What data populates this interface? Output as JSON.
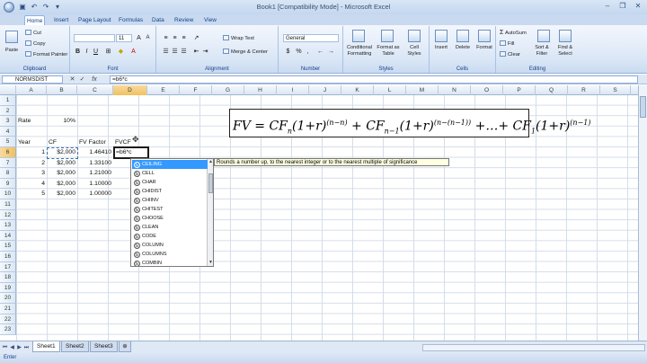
{
  "window": {
    "title": "Book1 [Compatibility Mode] - Microsoft Excel",
    "minimize": "–",
    "restore": "❐",
    "close": "✕"
  },
  "tabs": [
    "Home",
    "Insert",
    "Page Layout",
    "Formulas",
    "Data",
    "Review",
    "View"
  ],
  "ribbon": {
    "clipboard": {
      "label": "Clipboard",
      "paste": "Paste",
      "cut": "Cut",
      "copy": "Copy",
      "format_painter": "Format Painter"
    },
    "font": {
      "label": "Font",
      "font_name": "",
      "font_size": "11",
      "bold": "B",
      "italic": "I",
      "underline": "U"
    },
    "alignment": {
      "label": "Alignment",
      "wrap_text": "Wrap Text",
      "merge_center": "Merge & Center"
    },
    "number": {
      "label": "Number",
      "format": "General",
      "currency": "$",
      "percent": "%",
      "comma": ","
    },
    "styles": {
      "label": "Styles",
      "conditional": "Conditional Formatting",
      "format_table": "Format as Table",
      "cell_styles": "Cell Styles"
    },
    "cells": {
      "label": "Cells",
      "insert": "Insert",
      "delete": "Delete",
      "format": "Format"
    },
    "editing": {
      "label": "Editing",
      "autosum": "AutoSum",
      "fill": "Fill",
      "clear": "Clear",
      "sort_filter": "Sort & Filter",
      "find_select": "Find & Select"
    }
  },
  "formula_bar": {
    "name_box": "NORMSDIST",
    "formula": "=b6*c"
  },
  "columns": [
    "A",
    "B",
    "C",
    "D",
    "E",
    "F",
    "G",
    "H",
    "I",
    "J",
    "K",
    "L",
    "M",
    "N",
    "O",
    "P",
    "Q",
    "R",
    "S",
    "T"
  ],
  "rows": [
    "1",
    "2",
    "3",
    "4",
    "5",
    "6",
    "7",
    "8",
    "9",
    "10",
    "11",
    "12",
    "13",
    "14",
    "15",
    "16",
    "17",
    "18",
    "19",
    "20",
    "21",
    "22",
    "23"
  ],
  "sheet": {
    "rate_label": "Rate",
    "rate_value": "10%",
    "headers": [
      "Year",
      "CF",
      "FV Factor",
      "FVCF"
    ],
    "data": [
      {
        "year": "1",
        "cf": "$2,000",
        "factor": "1.46410"
      },
      {
        "year": "2",
        "cf": "$2,000",
        "factor": "1.33100"
      },
      {
        "year": "3",
        "cf": "$2,000",
        "factor": "1.21000"
      },
      {
        "year": "4",
        "cf": "$2,000",
        "factor": "1.10000"
      },
      {
        "year": "5",
        "cf": "$2,000",
        "factor": "1.00000"
      }
    ],
    "active_cell_text": "=b6*c"
  },
  "formula_image": {
    "lead": "FV = CF",
    "sub_n": "n",
    "p1": "(1+r)",
    "exp1": "(n−n)",
    "plus1": " + CF",
    "sub_n1": "n−1",
    "p2": "(1+r)",
    "exp2": "(n−(n−1))",
    "mid": " +…+ CF",
    "sub_1": "1",
    "p3": "(1+r)",
    "exp3": "(n−1)"
  },
  "autocomplete": {
    "items": [
      "CEILING",
      "CELL",
      "CHAR",
      "CHIDIST",
      "CHIINV",
      "CHITEST",
      "CHOOSE",
      "CLEAN",
      "CODE",
      "COLUMN",
      "COLUMNS",
      "COMBIN"
    ],
    "selected_index": 0,
    "fx_glyph": "fx",
    "tooltip": "Rounds a number up, to the nearest integer or to the nearest multiple of significance"
  },
  "sheet_tabs": [
    "Sheet1",
    "Sheet2",
    "Sheet3"
  ],
  "status": "Enter"
}
